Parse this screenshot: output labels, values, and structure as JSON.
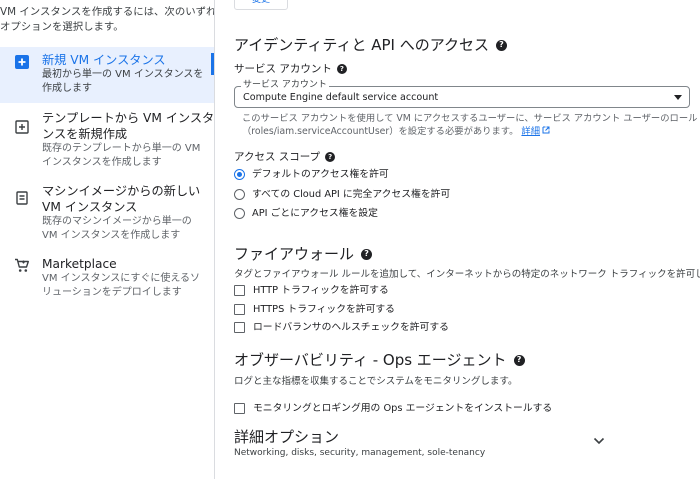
{
  "left_panel": {
    "intro_lines": [
      "VM インスタンスを作成するには、次のいずれかの",
      "オプションを選択します。"
    ],
    "options": [
      {
        "title": "新規 VM インスタンス",
        "desc": [
          "最初から単一の VM インスタンスを",
          "作成します"
        ],
        "icon": "add-box-icon",
        "selected": true
      },
      {
        "title": [
          "テンプレートから VM インスタ",
          "ンスを新規作成"
        ],
        "desc": [
          "既存のテンプレートから単一の VM",
          "インスタンスを作成します"
        ],
        "icon": "add-from-template-icon"
      },
      {
        "title": [
          "マシンイメージからの新しい",
          "VM インスタンス"
        ],
        "desc": [
          "既存のマシンイメージから単一の",
          "VM インスタンスを作成します"
        ],
        "icon": "machine-image-icon"
      },
      {
        "title": "Marketplace",
        "desc": [
          "VM インスタンスにすぐに使えるソ",
          "リューションをデプロイします"
        ],
        "icon": "cart-icon"
      }
    ]
  },
  "top_button_label": "変更",
  "identity": {
    "heading": "アイデンティティと API へのアクセス",
    "service_account_label": "サービス アカウント",
    "select_float_label": "サービス アカウント",
    "select_value": "Compute Engine default service account",
    "note_lines": [
      "このサービス アカウントを使用して VM にアクセスするユーザーに、サービス アカウント ユーザーのロール",
      "（roles/iam.serviceAccountUser）を設定する必要があります。"
    ],
    "note_link": "詳細",
    "access_scope_label": "アクセス スコープ",
    "scope_options": [
      "デフォルトのアクセス権を許可",
      "すべての Cloud API に完全アクセス権を許可",
      "API ごとにアクセス権を設定"
    ]
  },
  "firewall": {
    "heading": "ファイアウォール",
    "desc": "タグとファイアウォール ルールを追加して、インターネットからの特定のネットワーク トラフィックを許可します",
    "options": [
      "HTTP トラフィックを許可する",
      "HTTPS トラフィックを許可する",
      "ロードバランサのヘルスチェックを許可する"
    ]
  },
  "observability": {
    "heading": "オブザーバビリティ - Ops エージェント",
    "desc": "ログと主な指標を収集することでシステムをモニタリングします。",
    "option": "モニタリングとロギング用の Ops エージェントをインストールする"
  },
  "advanced": {
    "heading": "詳細オプション",
    "desc": "Networking, disks, security, management, sole-tenancy"
  },
  "colors": {
    "accent": "#1a73e8",
    "selected_bg": "#e8f0fe",
    "divider": "#dadce0"
  }
}
